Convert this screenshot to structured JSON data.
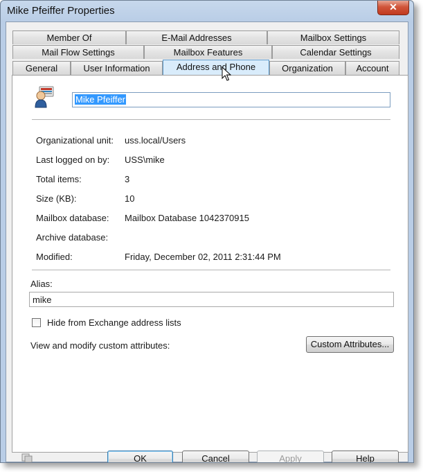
{
  "window": {
    "title": "Mike Pfeiffer Properties",
    "close_label": "✕"
  },
  "tabs": {
    "row1": [
      "Member Of",
      "E-Mail Addresses",
      "Mailbox Settings"
    ],
    "row2": [
      "Mail Flow Settings",
      "Mailbox Features",
      "Calendar Settings"
    ],
    "row3": [
      "General",
      "User Information",
      "Address and Phone",
      "Organization",
      "Account"
    ],
    "active": "Address and Phone"
  },
  "general": {
    "display_name": "Mike Pfeiffer",
    "fields": [
      {
        "label": "Organizational unit:",
        "value": "uss.local/Users"
      },
      {
        "label": "Last logged on by:",
        "value": "USS\\mike"
      },
      {
        "label": "Total items:",
        "value": "3"
      },
      {
        "label": "Size (KB):",
        "value": "10"
      },
      {
        "label": "Mailbox database:",
        "value": "Mailbox Database 1042370915"
      },
      {
        "label": "Archive database:",
        "value": ""
      },
      {
        "label": "Modified:",
        "value": "Friday, December 02, 2011 2:31:44 PM"
      }
    ],
    "alias_label": "Alias:",
    "alias_value": "mike",
    "hide_label": "Hide from Exchange address lists",
    "hide_checked": false,
    "custom_label": "View and modify custom attributes:",
    "custom_button": "Custom Attributes..."
  },
  "footer": {
    "ok": "OK",
    "cancel": "Cancel",
    "apply": "Apply",
    "help": "Help"
  }
}
